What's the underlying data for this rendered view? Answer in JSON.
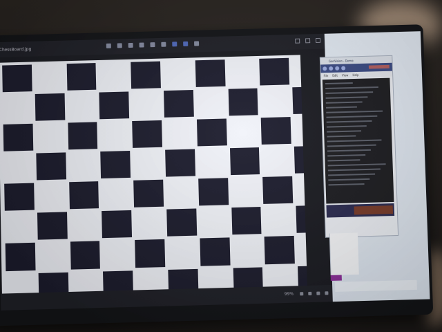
{
  "viewer": {
    "file_name": "ChessBoard.jpg",
    "zoom": "99%",
    "toolbar_icons": [
      "rotate-icon",
      "copy-icon",
      "delete-icon",
      "favorite-icon",
      "edit-icon",
      "crop-icon",
      "draw-icon",
      "share-icon",
      "more-icon"
    ],
    "window_buttons": [
      "minimize-icon",
      "maximize-icon",
      "close-icon"
    ]
  },
  "checkerboard": {
    "columns": 10,
    "rows": 7,
    "dark_color": "#1d1d2e",
    "light_color": "#f2f4fa"
  },
  "side_app": {
    "title": "GenVision - Demo",
    "menu": [
      "File",
      "Edit",
      "View",
      "Help"
    ]
  }
}
